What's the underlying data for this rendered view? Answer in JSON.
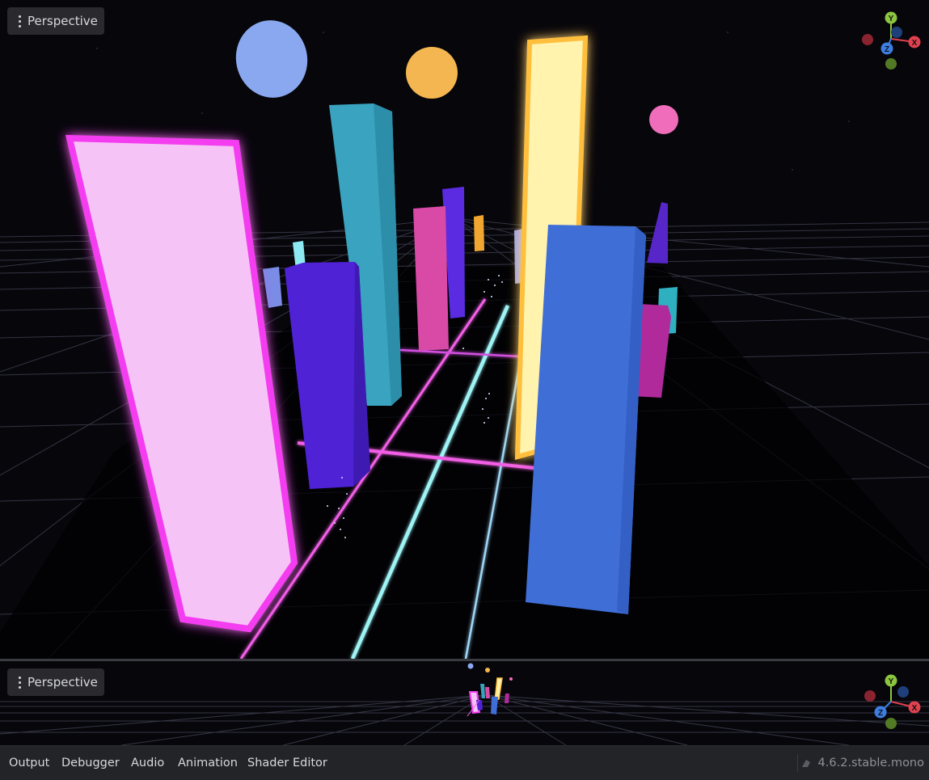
{
  "viewport_top": {
    "menu_label": "Perspective"
  },
  "viewport_bottom": {
    "menu_label": "Perspective"
  },
  "gizmo": {
    "y": "Y",
    "x": "X",
    "z": "Z"
  },
  "bottom_panel": {
    "tabs": [
      "Output",
      "Debugger",
      "Audio",
      "Animation",
      "Shader Editor"
    ],
    "version": "4.6.2.stable.mono"
  },
  "colors": {
    "neon_pink": "#f43cf0",
    "neon_yellow": "#ffc23a",
    "cyan": "#8ef3f7",
    "gizmo_x": "#e0414f",
    "gizmo_y": "#8cc63f",
    "gizmo_z": "#3d7ee2"
  }
}
